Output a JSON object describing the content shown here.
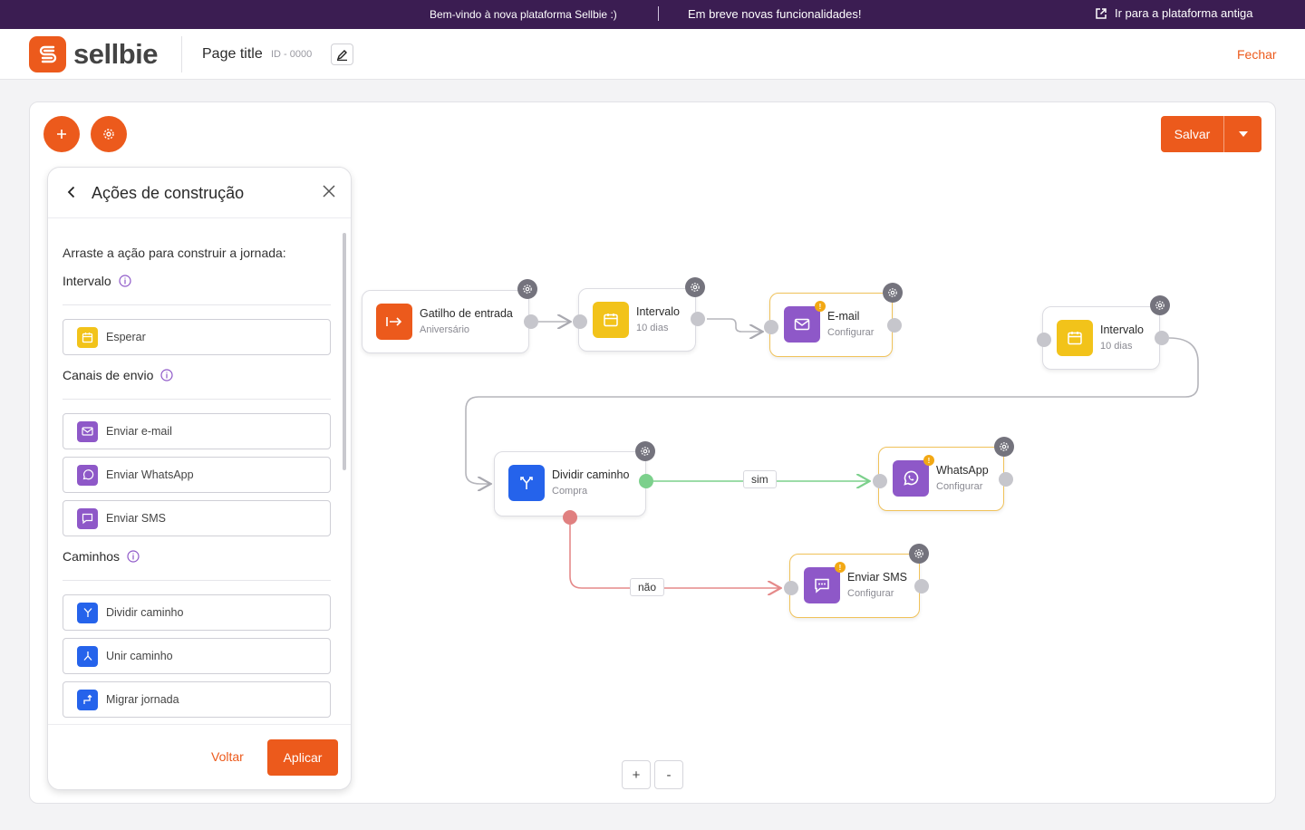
{
  "topbar": {
    "welcome": "Bem-vindo à nova plataforma Sellbie :)",
    "soon": "Em breve novas funcionalidades!",
    "old_link": "Ir para a plataforma antiga"
  },
  "header": {
    "brand": "sellbie",
    "page_title": "Page title",
    "page_id": "ID - 0000",
    "close": "Fechar"
  },
  "toolbar": {
    "save_label": "Salvar"
  },
  "panel": {
    "title": "Ações de construção",
    "intro": "Arraste a ação para construir a jornada:",
    "sections": [
      {
        "title": "Intervalo",
        "items": [
          "Esperar"
        ]
      },
      {
        "title": "Canais de envio",
        "items": [
          "Enviar e-mail",
          "Enviar WhatsApp",
          "Enviar SMS"
        ]
      },
      {
        "title": "Caminhos",
        "items": [
          "Dividir caminho",
          "Unir caminho",
          "Migrar jornada"
        ]
      }
    ],
    "back": "Voltar",
    "apply": "Aplicar"
  },
  "flow": {
    "nodes": [
      {
        "title": "Gatilho de entrada",
        "sub": "Aniversário"
      },
      {
        "title": "Intervalo",
        "sub": "10 dias"
      },
      {
        "title": "E-mail",
        "sub": "Configurar"
      },
      {
        "title": "Intervalo",
        "sub": "10 dias"
      },
      {
        "title": "Dividir caminho",
        "sub": "Compra"
      },
      {
        "title": "WhatsApp",
        "sub": "Configurar"
      },
      {
        "title": "Enviar SMS",
        "sub": "Configurar"
      }
    ],
    "labels": {
      "yes": "sim",
      "no": "não"
    }
  },
  "zoom": {
    "in": "+",
    "out": "-"
  },
  "colors": {
    "brand": "#ec5a1c",
    "topbar": "#3b1d52",
    "yellow": "#f2c31a",
    "purple": "#8e58c8",
    "blue": "#2563eb",
    "warning": "#f2a814",
    "yes_path": "#7cd08c",
    "no_path": "#e58a8a"
  },
  "icons": [
    "external-link-icon",
    "edit-icon",
    "plus-icon",
    "gear-icon",
    "chevron-down-icon",
    "back-icon",
    "close-icon",
    "info-icon",
    "calendar-icon",
    "mail-icon",
    "whatsapp-icon",
    "chat-icon",
    "split-icon",
    "merge-icon",
    "migrate-icon",
    "entry-icon"
  ]
}
